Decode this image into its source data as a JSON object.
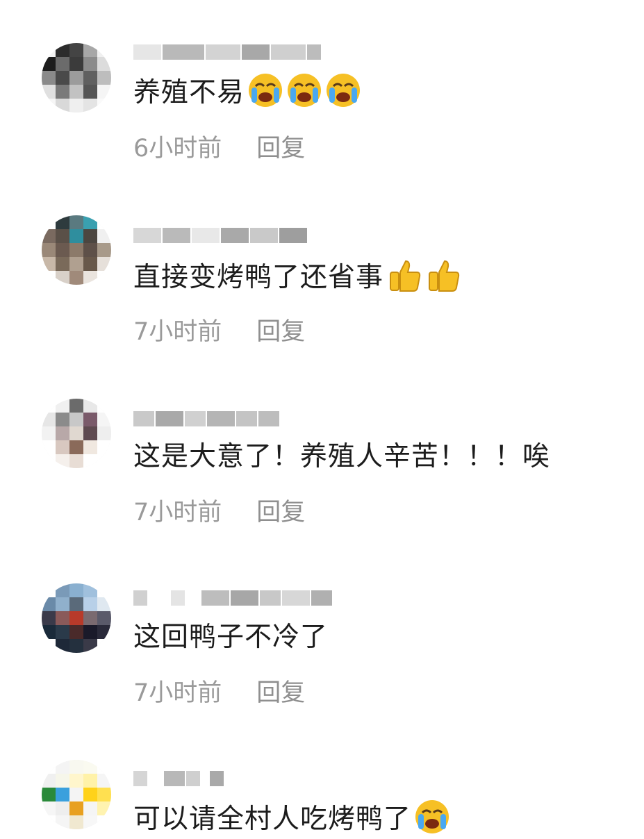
{
  "colors": {
    "text": "#1c1c1c",
    "meta": "#9a9a9a",
    "background": "#ffffff"
  },
  "comments": [
    {
      "text": "养殖不易",
      "emojis": [
        "loudly-crying-face",
        "loudly-crying-face",
        "loudly-crying-face"
      ],
      "time": "6小时前",
      "reply_label": "回复"
    },
    {
      "text": "直接变烤鸭了还省事",
      "emojis": [
        "thumbs-up",
        "thumbs-up"
      ],
      "time": "7小时前",
      "reply_label": "回复"
    },
    {
      "text": "这是大意了！养殖人辛苦！！！唉",
      "emojis": [],
      "time": "7小时前",
      "reply_label": "回复"
    },
    {
      "text": "这回鸭子不冷了",
      "emojis": [],
      "time": "7小时前",
      "reply_label": "回复"
    },
    {
      "text": "可以请全村人吃烤鸭了",
      "emojis": [
        "loudly-crying-face"
      ],
      "time": "",
      "reply_label": ""
    }
  ]
}
